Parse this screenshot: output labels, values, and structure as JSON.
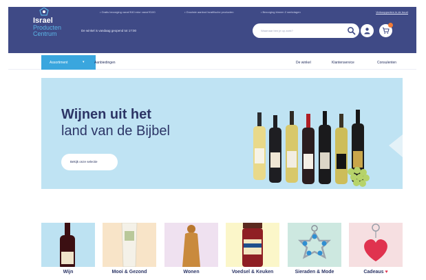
{
  "topbar": {
    "usps": [
      "• Gratis bezorging vanaf €40 edor vanaf €100",
      "• Grootste aanbod Israëlische producten",
      "• Bezorging binnen 2 werkdagen"
    ],
    "link": "Verkooppunten in de buurt"
  },
  "logo": {
    "line1": "Israel",
    "line2": "Producten",
    "line3": "Centrum"
  },
  "store_status": "De winkel is vandaag geopend tot 17:00",
  "search": {
    "placeholder": "Waarnaar ben je op zoek?"
  },
  "nav": {
    "category_button": "Assortiment",
    "offers": "Aanbiedingen",
    "shop": "De winkel",
    "service": "Klantenservice",
    "consultants": "Consulenten"
  },
  "hero": {
    "title_line1": "Wijnen uit het",
    "title_line2": "land van de Bijbel",
    "cta": "Bekijk onze selectie"
  },
  "categories": [
    {
      "label": "Wijn"
    },
    {
      "label": "Mooi & Gezond"
    },
    {
      "label": "Wonen"
    },
    {
      "label": "Voedsel & Keuken"
    },
    {
      "label": "Sieraden & Mode"
    },
    {
      "label": "Cadeaus",
      "suffix": "♥"
    }
  ],
  "colors": {
    "header": "#3f4a86",
    "accent": "#3aa6de",
    "hero_bg": "#bfe3f3",
    "cart_badge": "#f27a35"
  },
  "icons": [
    "search-icon",
    "user-icon",
    "cart-icon",
    "chevron-down-icon",
    "heart-icon"
  ]
}
